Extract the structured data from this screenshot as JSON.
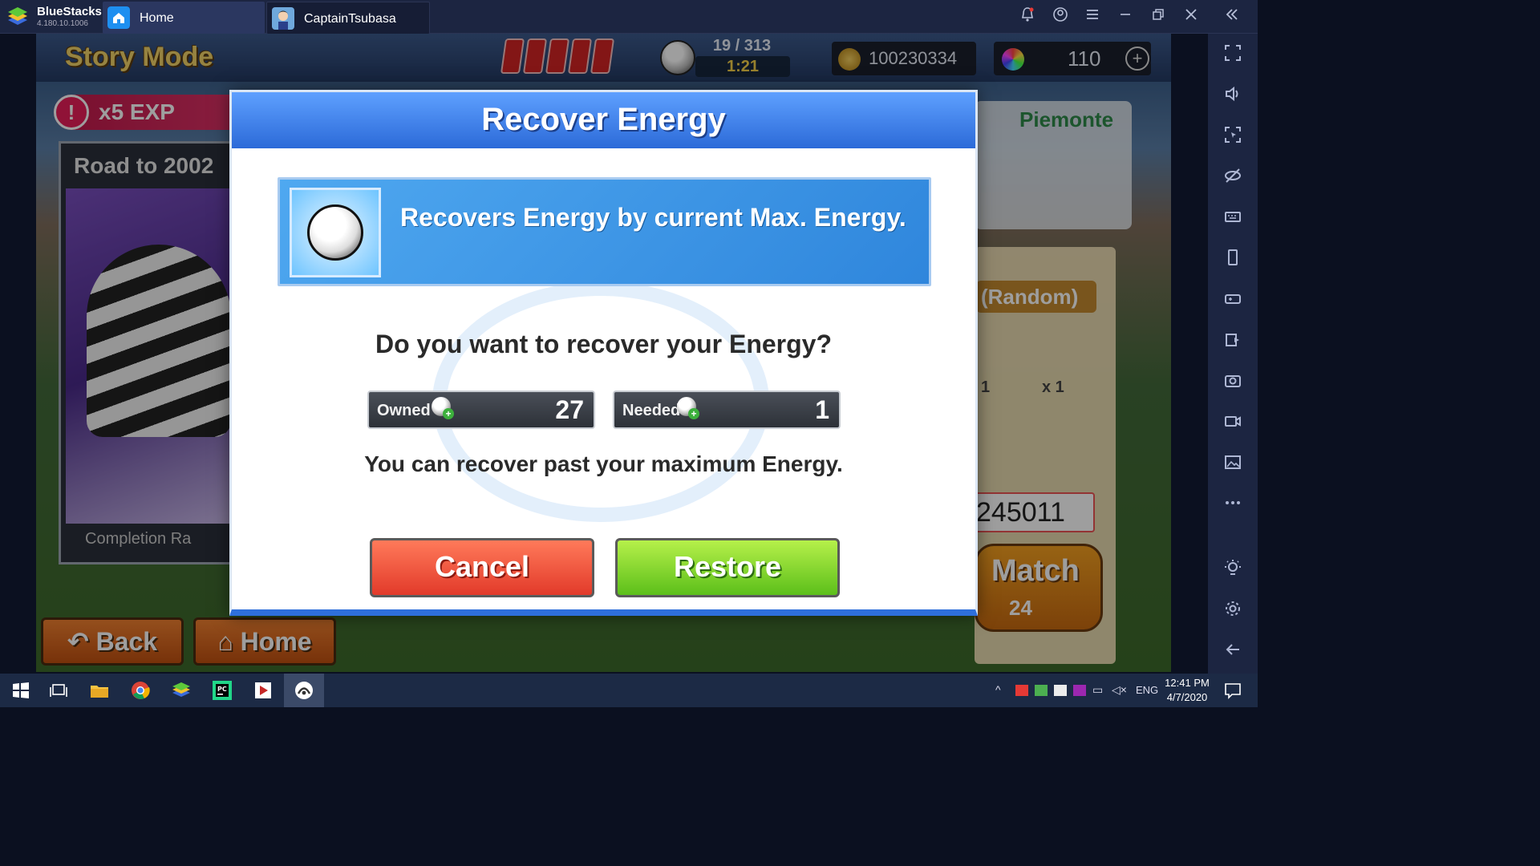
{
  "window": {
    "app_name": "BlueStacks",
    "app_version": "4.180.10.1006",
    "tabs": [
      {
        "label": "Home",
        "icon": "home-icon"
      },
      {
        "label": "CaptainTsubasa",
        "icon": "game-thumbnail"
      }
    ],
    "controls": [
      "bell-icon",
      "account-icon",
      "menu-icon",
      "minimize-icon",
      "restore-icon",
      "close-icon",
      "collapse-sidebar-icon"
    ]
  },
  "sidebar": {
    "items": [
      "fullscreen-icon",
      "volume-icon",
      "lock-cursor-icon",
      "eye-off-icon",
      "keyboard-icon",
      "portrait-icon",
      "gamepad-icon",
      "install-apk-icon",
      "screenshot-icon",
      "record-icon",
      "media-manager-icon",
      "more-icon",
      "brightness-icon",
      "settings-icon",
      "back-icon"
    ]
  },
  "game": {
    "header": {
      "title": "Story Mode",
      "energy": "19 / 313",
      "energy_timer": "1:21",
      "coins": "100230334",
      "gems": "110"
    },
    "background": {
      "exp_banner": "x5 EXP",
      "road_title": "Road to 2002",
      "road_footer": "Completion Ra",
      "team_label": "Piemonte",
      "reward_label": "(Random)",
      "reward_counts": [
        "1",
        "x 1"
      ],
      "id_number": "245011",
      "match_label": "Match",
      "match_number": "24",
      "back_button": "Back",
      "home_button": "Home"
    }
  },
  "modal": {
    "title": "Recover Energy",
    "info": "Recovers Energy by current Max. Energy.",
    "question": "Do you want to recover your Energy?",
    "owned_label": "Owned",
    "owned_value": "27",
    "needed_label": "Needed",
    "needed_value": "1",
    "note": "You can recover past your maximum Energy.",
    "cancel": "Cancel",
    "restore": "Restore"
  },
  "taskbar": {
    "apps": [
      "start-icon",
      "task-view-icon",
      "file-explorer-icon",
      "chrome-icon",
      "bluestacks-icon",
      "pycharm-icon",
      "media-player-icon",
      "game-app-icon"
    ],
    "tray_lang": "ENG",
    "time": "12:41 PM",
    "date": "4/7/2020"
  },
  "colors": {
    "titlebar": "#1c2541",
    "modal_header": "#2c6ad8",
    "cancel": "#e23a2a",
    "restore": "#5cbf1a"
  }
}
